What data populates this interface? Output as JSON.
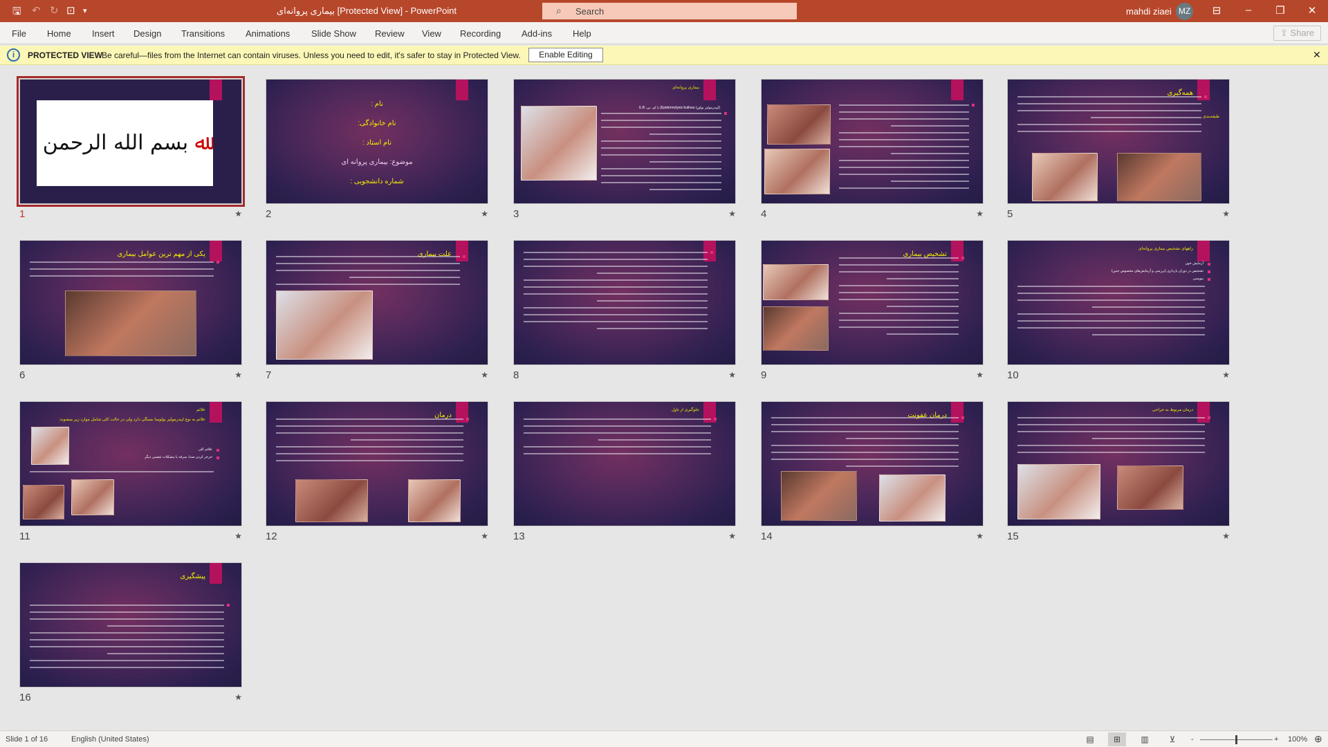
{
  "titlebar": {
    "doc_title": "بیماری پروانه‌ای [Protected View]  -  PowerPoint",
    "search_placeholder": "Search",
    "user_name": "mahdi ziaei",
    "user_initials": "MZ",
    "icons": [
      "save-icon",
      "undo-icon",
      "redo-icon",
      "present-from-start-icon",
      "customize-qat-icon"
    ]
  },
  "menu": {
    "tabs": [
      "File",
      "Home",
      "Insert",
      "Design",
      "Transitions",
      "Animations",
      "Slide Show",
      "Review",
      "View",
      "Recording",
      "Add-ins",
      "Help"
    ],
    "share_label": "Share"
  },
  "protected_view": {
    "label": "PROTECTED VIEW",
    "message": "Be careful—files from the Internet can contain viruses. Unless you need to edit, it's safer to stay in Protected View.",
    "button": "Enable Editing"
  },
  "colors": {
    "titlebar": "#b7472a",
    "accent_pink": "#b5125e",
    "slide_title": "#f5f000",
    "selection": "#a52a2a"
  },
  "slides": [
    {
      "number": "1",
      "selected": true,
      "logo_text": "بسم الله الرحمن الرحیم"
    },
    {
      "number": "2",
      "lines": [
        "نام :",
        "نام خانوادگی:",
        "نام استاد :",
        "موضوع: بیماری پروانه ای",
        "شماره دانشجویی :"
      ]
    },
    {
      "number": "3",
      "title": "بیماری پروانه‌ای",
      "lead": "(اپیدرمولیز بولوزا Epidermolysis bullosa) یا ای. بی. E.B"
    },
    {
      "number": "4"
    },
    {
      "number": "5",
      "title": "همه‌گیری",
      "subtitle": "طبقه‌بندی"
    },
    {
      "number": "6",
      "title": "یکی از مهم ترین عوامل بیماری"
    },
    {
      "number": "7",
      "title": "علت بیماری"
    },
    {
      "number": "8"
    },
    {
      "number": "9",
      "title": "تشخیص بیماری"
    },
    {
      "number": "10",
      "title": "راههای تشخیص بیماری پروانه‌ای",
      "bullets": [
        "آزمایش خون",
        "تشخیص در دوران بارداری (بررسی و آزمایش‌های مخصوص جنین)",
        "بیوپسی"
      ]
    },
    {
      "number": "11",
      "title": "علائم",
      "subtitle": "علائم به نوع اپیدرمولیز بولوسا بستگی دارد ولی در حالت کلی شامل موارد زیر میشوند:",
      "bullets": [
        "علائم کلی",
        "خرخر کردن صدا، سرفه یا مشکلات تنفسی دیگر"
      ]
    },
    {
      "number": "12",
      "title": "درمان"
    },
    {
      "number": "13",
      "title": "جلوگیری از تاول"
    },
    {
      "number": "14",
      "title": "درمان عفونت"
    },
    {
      "number": "15",
      "title": "درمان مربوط به جراحی"
    },
    {
      "number": "16",
      "title": "پیشگیری"
    }
  ],
  "statusbar": {
    "slide_info": "Slide 1 of 16",
    "language": "English (United States)",
    "zoom": "100%",
    "zoom_level": 0.5
  }
}
